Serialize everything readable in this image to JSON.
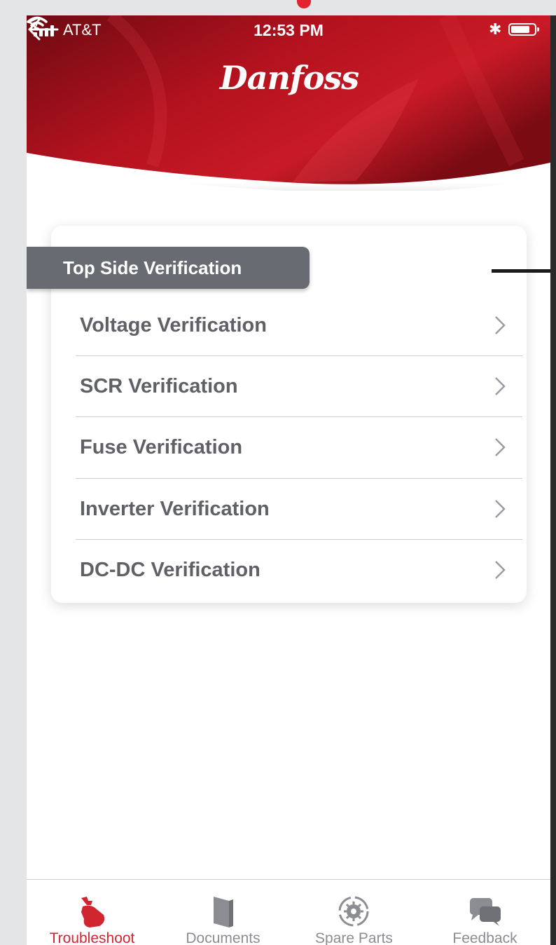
{
  "status_bar": {
    "carrier": "AT&T",
    "time": "12:53 PM"
  },
  "header": {
    "logo_text": "Danfoss"
  },
  "section": {
    "title": "Top Side Verification"
  },
  "menu": {
    "items": [
      {
        "label": "Voltage Verification"
      },
      {
        "label": "SCR Verification"
      },
      {
        "label": "Fuse Verification"
      },
      {
        "label": "Inverter Verification"
      },
      {
        "label": "DC-DC Verification"
      }
    ]
  },
  "tabbar": {
    "active_color": "#d0262f",
    "inactive_color": "#8b8d92",
    "tabs": [
      {
        "label": "Troubleshoot",
        "icon": "wrench-hand-icon",
        "active": true
      },
      {
        "label": "Documents",
        "icon": "book-icon",
        "active": false
      },
      {
        "label": "Spare Parts",
        "icon": "gear-cycle-icon",
        "active": false
      },
      {
        "label": "Feedback",
        "icon": "chat-bubbles-icon",
        "active": false
      }
    ]
  },
  "colors": {
    "header_red": "#b3121e",
    "section_tag_bg": "#686b72",
    "menu_text": "#5f6167"
  }
}
